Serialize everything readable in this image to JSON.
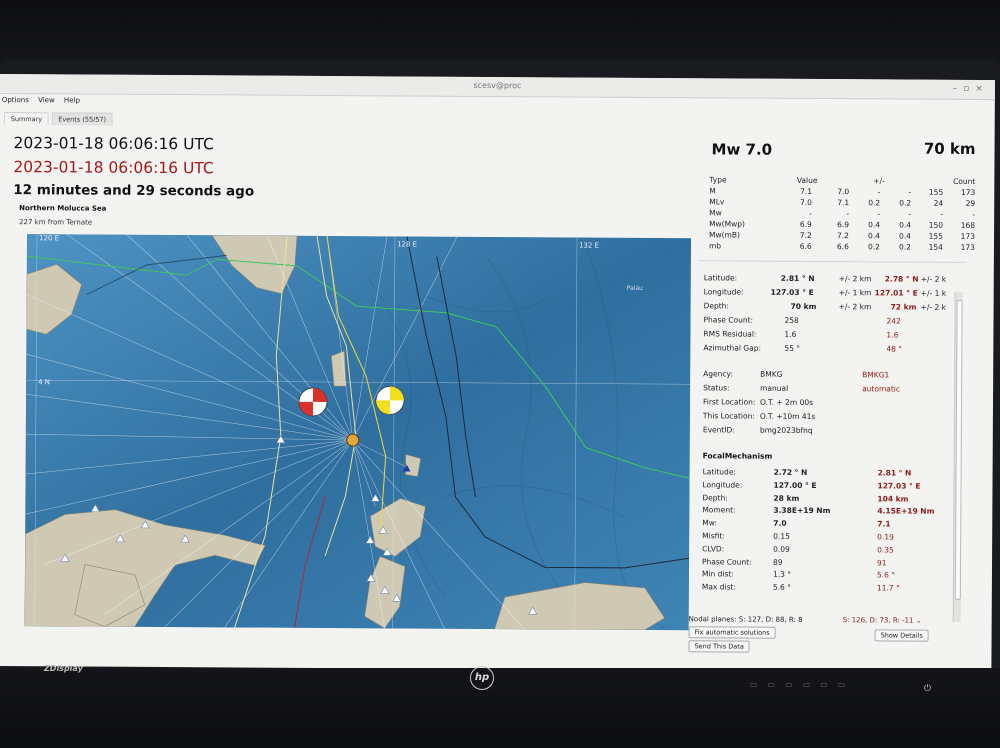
{
  "window": {
    "title": "scesv@proc"
  },
  "menu": {
    "items": [
      "Options",
      "View",
      "Help"
    ]
  },
  "tabs": [
    "Summary",
    "Events (55/57)"
  ],
  "origin": {
    "time_utc": "2023-01-18 06:06:16 UTC",
    "time_utc_red": "2023-01-18 06:06:16 UTC",
    "ago": "12 minutes and 29 seconds ago",
    "region": "Northern Molucca Sea",
    "distance": "227 km from Ternate"
  },
  "map": {
    "lon_labels": [
      "120 E",
      "128 E",
      "132 E"
    ],
    "lat_label": "4 N",
    "place_label": "Palau",
    "colors": {
      "ocean": "#3d7fb0",
      "land": "#cfc9b4",
      "beach_red": "#d9322b",
      "beach_yellow": "#f2dd1f"
    }
  },
  "summary": {
    "magnitude": "Mw 7.0",
    "depth": "70 km",
    "mag_headers": [
      "Type",
      "Value",
      "+/-",
      "Count"
    ],
    "mag_rows": [
      [
        "M",
        "7.1",
        "7.0",
        "-",
        "-",
        "155",
        "173"
      ],
      [
        "MLv",
        "7.0",
        "7.1",
        "0.2",
        "0.2",
        "24",
        "29"
      ],
      [
        "Mw",
        "-",
        "-",
        "-",
        "-",
        "-",
        "-"
      ],
      [
        "Mw(Mwp)",
        "6.9",
        "6.9",
        "0.4",
        "0.4",
        "150",
        "168"
      ],
      [
        "Mw(mB)",
        "7.2",
        "7.2",
        "0.4",
        "0.4",
        "155",
        "173"
      ],
      [
        "mb",
        "6.6",
        "6.6",
        "0.2",
        "0.2",
        "154",
        "173"
      ]
    ]
  },
  "details": {
    "latitude": {
      "label": "Latitude:",
      "v1": "2.81 ° N",
      "u1": "+/-  2 km",
      "v2": "2.78 ° N",
      "u2": "+/-  2 k"
    },
    "longitude": {
      "label": "Longitude:",
      "v1": "127.03 ° E",
      "u1": "+/-  1 km",
      "v2": "127.01 ° E",
      "u2": "+/-  1 k"
    },
    "depth": {
      "label": "Depth:",
      "v1": "70 km",
      "u1": "+/-  2 km",
      "v2": "72 km",
      "u2": "+/-  2 k"
    },
    "phase_count": {
      "label": "Phase Count:",
      "v1": "258",
      "v2": "242"
    },
    "rms": {
      "label": "RMS Residual:",
      "v1": "1.6",
      "v2": "1.6"
    },
    "azgap": {
      "label": "Azimuthal Gap:",
      "v1": "55 °",
      "v2": "48 °"
    },
    "agency": {
      "label": "Agency:",
      "v1": "BMKG",
      "v2": "BMKG1"
    },
    "status": {
      "label": "Status:",
      "v1": "manual",
      "v2": "automatic"
    },
    "first_loc": {
      "label": "First Location:",
      "v1": "O.T. + 2m 00s"
    },
    "this_loc": {
      "label": "This Location:",
      "v1": "O.T. +10m 41s"
    },
    "event_id": {
      "label": "EventID:",
      "v1": "bmg2023bfnq"
    }
  },
  "focal": {
    "title": "FocalMechanism",
    "rows": [
      {
        "label": "Latitude:",
        "v1": "2.72 ° N",
        "v2": "2.81 ° N",
        "bold": true
      },
      {
        "label": "Longitude:",
        "v1": "127.00 ° E",
        "v2": "127.03 ° E",
        "bold": true
      },
      {
        "label": "Depth:",
        "v1": "28 km",
        "v2": "104 km",
        "bold": true
      },
      {
        "label": "Moment:",
        "v1": "3.38E+19 Nm",
        "v2": "4.15E+19 Nm",
        "bold": true
      },
      {
        "label": "Mw:",
        "v1": "7.0",
        "v2": "7.1",
        "bold": true
      },
      {
        "label": "Misfit:",
        "v1": "0.15",
        "v2": "0.19",
        "bold": false
      },
      {
        "label": "CLVD:",
        "v1": "0.09",
        "v2": "0.35",
        "bold": false
      },
      {
        "label": "Phase Count:",
        "v1": "89",
        "v2": "91",
        "bold": false
      },
      {
        "label": "Min dist:",
        "v1": "1.3 °",
        "v2": "5.6 °",
        "bold": false
      },
      {
        "label": "Max dist:",
        "v1": "5.6 °",
        "v2": "11.7 °",
        "bold": false
      }
    ],
    "nodal_label": "Nodal planes: S: 127, D: 88, R: 8",
    "nodal_select": "S: 126, D: 73, R: -11"
  },
  "buttons": {
    "fix": "Fix automatic solutions",
    "send": "Send This Data",
    "show_details": "Show Details"
  },
  "monitor": {
    "brand": "ZDisplay",
    "logo": "hp"
  }
}
